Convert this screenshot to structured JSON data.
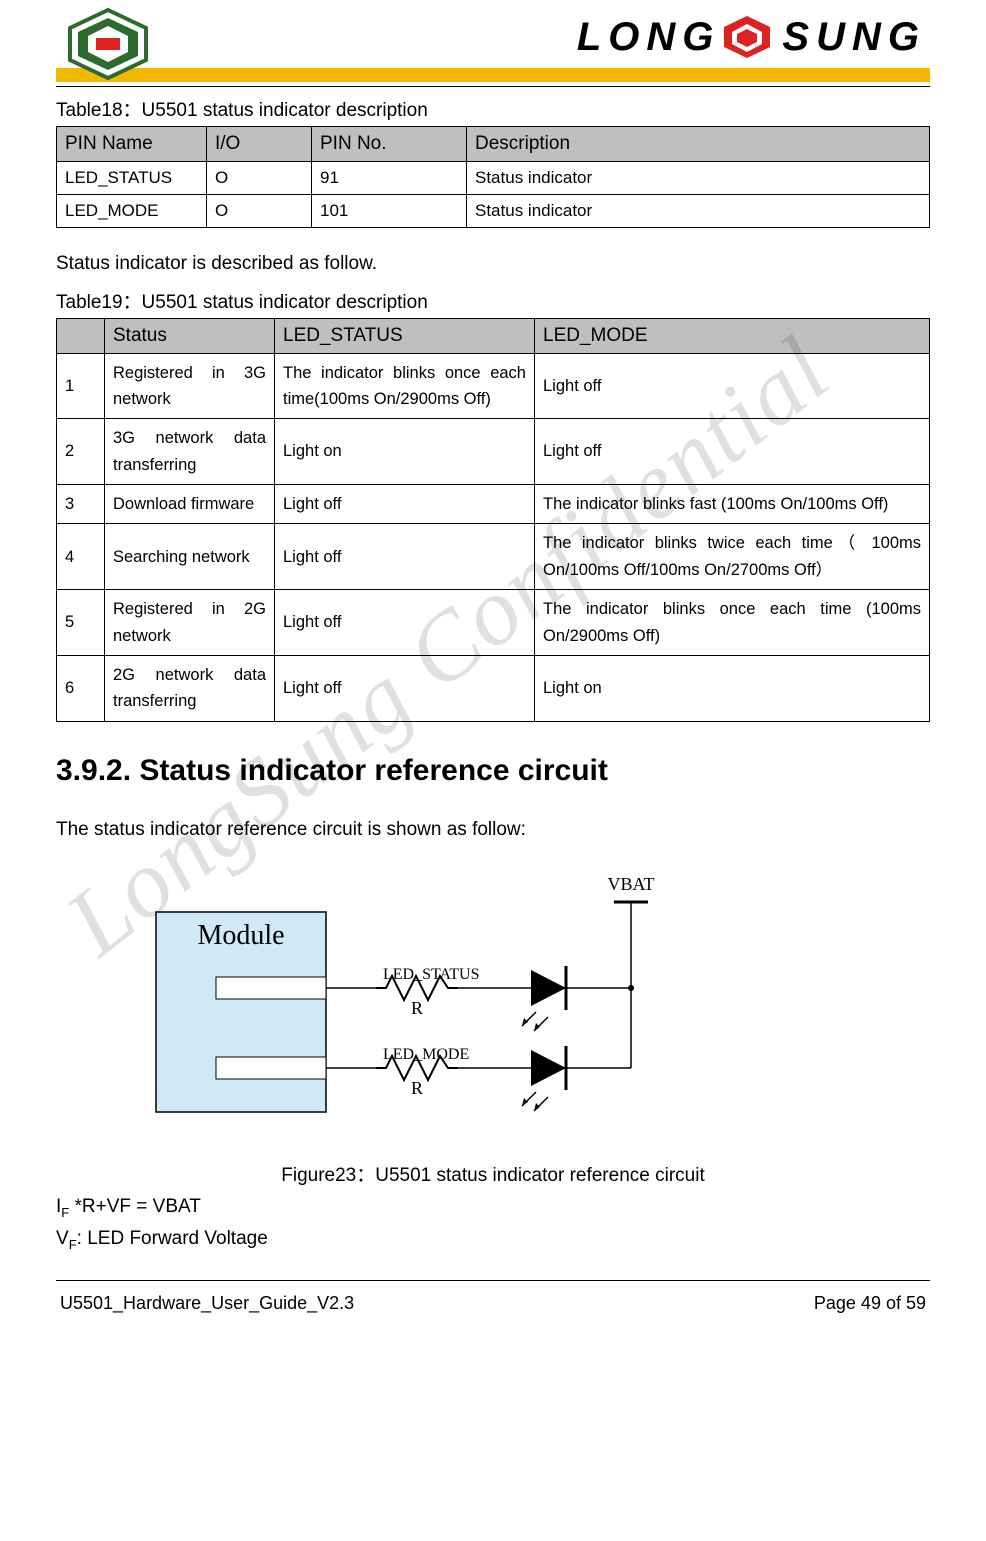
{
  "brand": {
    "name": "LONGSUNG"
  },
  "watermark": "LongSung Confidential",
  "table18": {
    "caption": "Table18：U5501 status indicator description",
    "headers": [
      "PIN Name",
      "I/O",
      "PIN No.",
      "Description"
    ],
    "rows": [
      {
        "pin": "LED_STATUS",
        "io": "O",
        "no": "91",
        "desc": "Status indicator"
      },
      {
        "pin": "LED_MODE",
        "io": "O",
        "no": "101",
        "desc": "Status indicator"
      }
    ]
  },
  "para1": "Status indicator is described as follow.",
  "table19": {
    "caption": "Table19：U5501 status indicator description",
    "headers": [
      "",
      "Status",
      "LED_STATUS",
      "LED_MODE"
    ],
    "rows": [
      {
        "n": "1",
        "status": "Registered in 3G network",
        "led_status": "The indicator blinks once each time(100ms On/2900ms Off)",
        "led_mode": "Light off"
      },
      {
        "n": "2",
        "status": "3G network data transferring",
        "led_status": "Light on",
        "led_mode": "Light off"
      },
      {
        "n": "3",
        "status": "Download firmware",
        "led_status": "Light off",
        "led_mode": "The indicator blinks fast (100ms On/100ms Off)"
      },
      {
        "n": "4",
        "status": "Searching network",
        "led_status": "Light off",
        "led_mode": "The indicator blinks twice each time（ 100ms On/100ms Off/100ms On/2700ms Off）"
      },
      {
        "n": "5",
        "status": "Registered in 2G network",
        "led_status": "Light off",
        "led_mode": "The indicator blinks once each time (100ms On/2900ms Off)"
      },
      {
        "n": "6",
        "status": "2G network data transferring",
        "led_status": "Light off",
        "led_mode": "Light on"
      }
    ]
  },
  "section_title": "3.9.2. Status indicator reference circuit",
  "para2": "The status indicator reference circuit is shown as follow:",
  "figure": {
    "module": "Module",
    "sig1": "LED_STATUS",
    "sig2": "LED_MODE",
    "r": "R",
    "vbat": "VBAT",
    "caption": "Figure23：U5501 status indicator reference circuit"
  },
  "eq1_pre": "I",
  "eq1_sub": "F",
  "eq1_post": " *R+VF = VBAT",
  "eq2_pre": "V",
  "eq2_sub": "F",
  "eq2_post": ": LED Forward Voltage",
  "footer": {
    "left": "U5501_Hardware_User_Guide_V2.3",
    "right": "Page 49 of 59"
  }
}
